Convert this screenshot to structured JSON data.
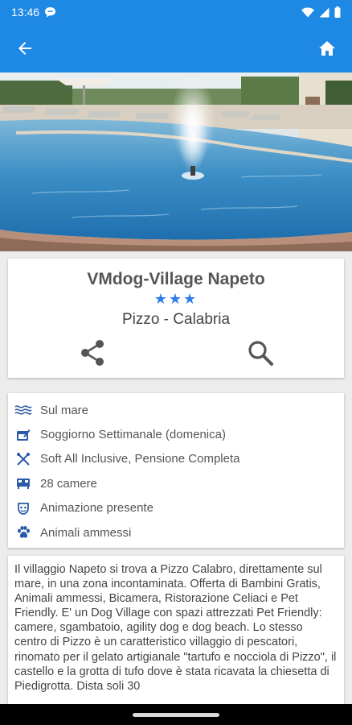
{
  "status_bar": {
    "time": "13:46",
    "icons": [
      "chat-bubble-icon",
      "wifi-icon",
      "cellular-icon",
      "battery-icon"
    ]
  },
  "app_bar": {
    "back_icon": "arrow-left-icon",
    "home_icon": "home-icon",
    "background": "#1e88e5"
  },
  "hero": {
    "scene": "pool-with-fountain"
  },
  "village": {
    "name": "VMdog-Village Napeto",
    "stars": "★★★",
    "rating": 3,
    "location": "Pizzo - Calabria",
    "actions": {
      "share_icon": "share-icon",
      "search_icon": "search-icon"
    }
  },
  "features": [
    {
      "icon": "waves-icon",
      "label": "Sul mare"
    },
    {
      "icon": "calendar-icon",
      "label": "Soggiorno Settimanale (domenica)"
    },
    {
      "icon": "cutlery-icon",
      "label": "Soft All Inclusive, Pensione Completa"
    },
    {
      "icon": "bed-icon",
      "label": "28 camere"
    },
    {
      "icon": "mask-icon",
      "label": "Animazione presente"
    },
    {
      "icon": "paw-icon",
      "label": "Animali ammessi"
    }
  ],
  "description": "Il villaggio Napeto si trova a Pizzo Calabro, direttamente sul mare, in una zona incontaminata. Offerta di Bambini Gratis, Animali ammessi, Bicamera, Ristorazione Celiaci e Pet Friendly. E' un Dog Village con spazi attrezzati Pet Friendly: camere, sgambatoio, agility dog e dog beach. Lo stesso centro di Pizzo è un caratteristico villaggio di pescatori, rinomato per il gelato artigianale \"tartufo e nocciola di Pizzo\", il castello e la grotta di tufo dove è stata ricavata la chiesetta di Piedigrotta. Dista soli 30",
  "colors": {
    "accent": "#1e88e5",
    "star": "#2b7de9",
    "icon": "#2a5aa8"
  }
}
